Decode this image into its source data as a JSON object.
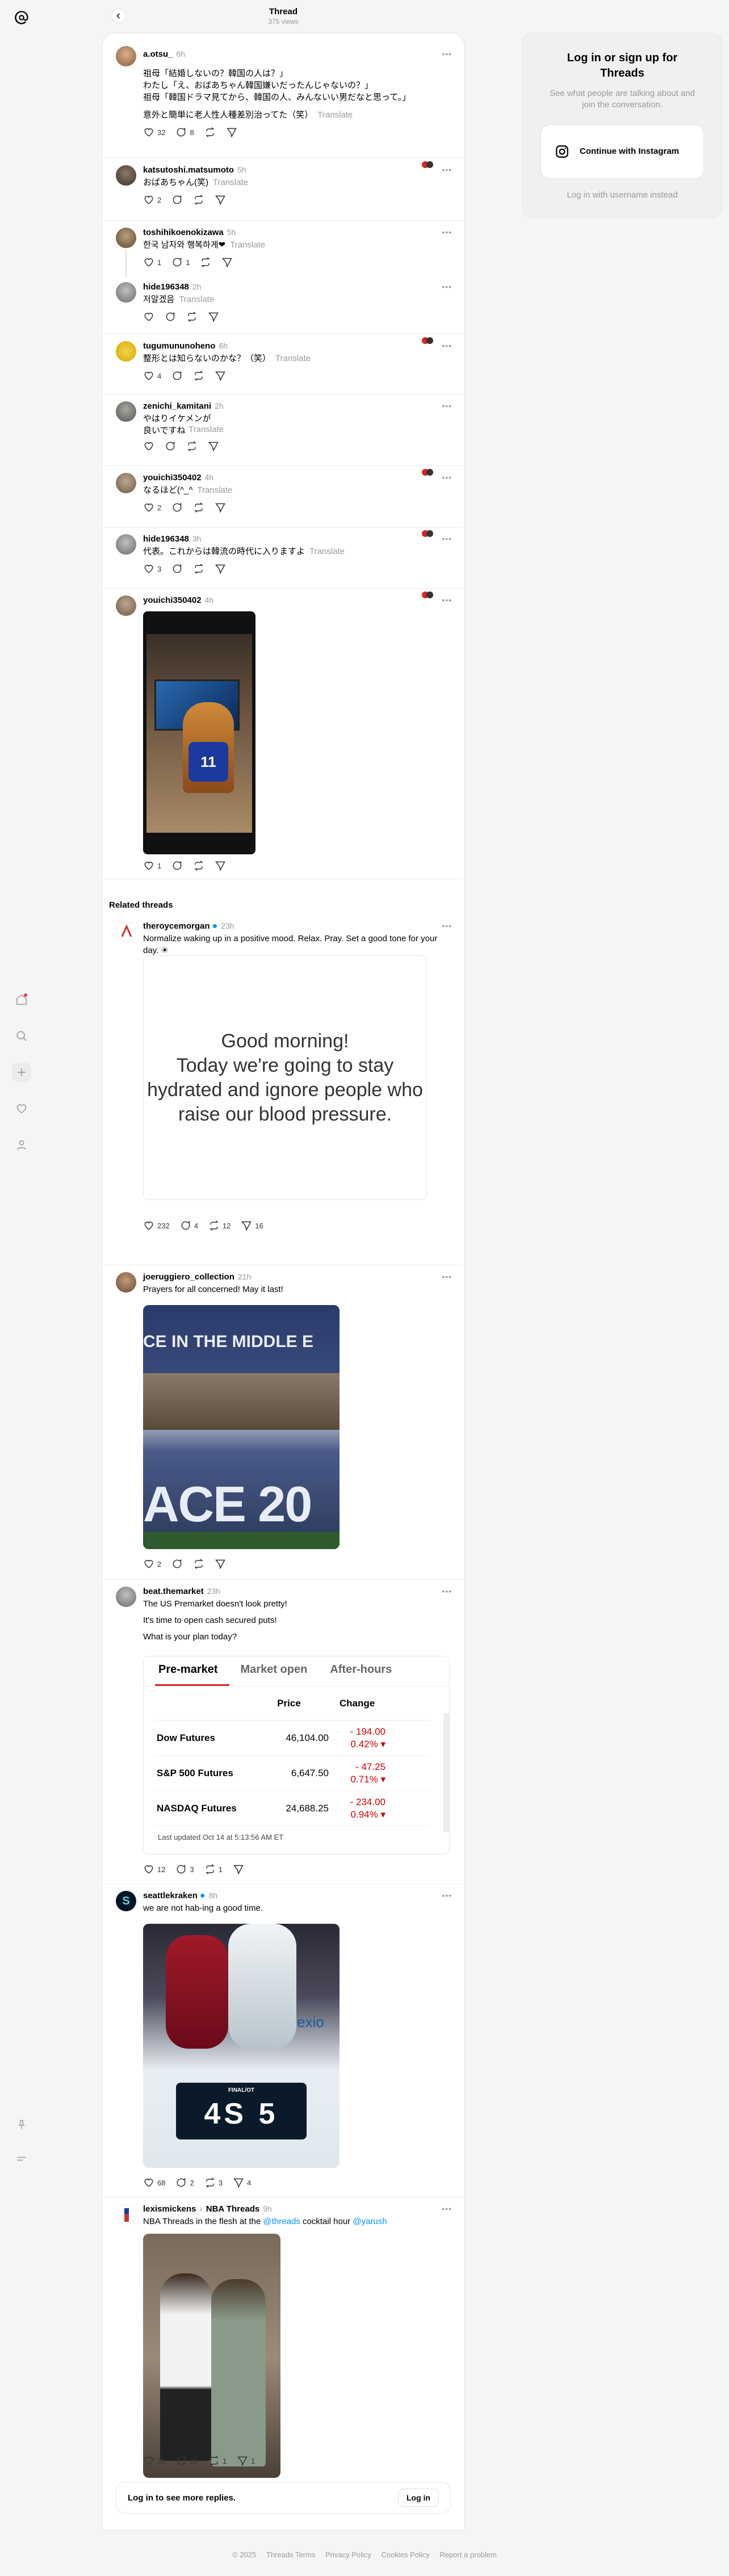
{
  "header": {
    "title": "Thread",
    "subtitle": "375 views"
  },
  "main_post": {
    "username": "a.otsu_",
    "time": "6h",
    "text": "祖母「結婚しないの？韓国の人は？」\nわたし「え、おばあちゃん韓国嫌いだったんじゃないの？」\n祖母「韓国ドラマ見てから、韓国の人、みんないい男だなと思って。」",
    "text2": "意外と簡単に老人性人種差別治ってた（笑）",
    "translate": "Translate",
    "likes": "32",
    "replies": "8"
  },
  "replies": [
    {
      "username": "katsutoshi.matsumoto",
      "time": "5h",
      "text": "おばあちゃん(笑)",
      "translate": "Translate",
      "likes": "2"
    },
    {
      "username": "toshihikoenokizawa",
      "time": "5h",
      "text": "한국 남자와 행복하게❤",
      "translate": "Translate",
      "likes": "1",
      "replies": "1"
    },
    {
      "username": "hide196348",
      "time": "2h",
      "text": "저알겠음",
      "translate": "Translate"
    },
    {
      "username": "tugumununoheno",
      "time": "6h",
      "text": "整形とは知らないのかな？（笑）",
      "translate": "Translate",
      "likes": "4"
    },
    {
      "username": "zenichi_kamitani",
      "time": "2h",
      "text": "やはりイケメンが\n良いですね",
      "translate": "Translate"
    },
    {
      "username": "youichi350402",
      "time": "4h",
      "text": "なるほど(^_^",
      "translate": "Translate",
      "likes": "2"
    },
    {
      "username": "hide196348",
      "time": "3h",
      "text": "代表。これからは韓流の時代に入りますよ",
      "translate": "Translate",
      "likes": "3"
    },
    {
      "username": "youichi350402",
      "time": "4h",
      "likes": "1"
    }
  ],
  "related_heading": "Related threads",
  "related": [
    {
      "username": "theroycemorgan",
      "time": "23h",
      "text": "Normalize waking up in a positive mood. Relax. Pray. Set a good tone for your day. ☀",
      "image_text": "Good morning!\nToday we're going to stay\nhydrated and ignore people who\nraise our blood pressure.",
      "likes": "232",
      "replies": "4",
      "reposts": "12",
      "shares": "16"
    },
    {
      "username": "joeruggiero_collection",
      "time": "21h",
      "text": "Prayers for all concerned! May it last!",
      "image_text_top": "CE IN THE MIDDLE E",
      "image_text_bottom": "ACE 20",
      "likes": "2"
    },
    {
      "username": "beat.themarket",
      "time": "23h",
      "text1": "The US Premarket doesn't look pretty!",
      "text2": "It's time to open cash secured puts!",
      "text3": "What is your plan today?",
      "likes": "12",
      "replies": "3",
      "reposts": "1"
    },
    {
      "username": "seattlekraken",
      "time": "8h",
      "text": "we are not hab-ing a good time.",
      "score_label": "FINAL/OT",
      "score_text": "4S 5",
      "board_text": "se connexio",
      "likes": "68",
      "replies": "2",
      "reposts": "3",
      "shares": "4"
    },
    {
      "username": "lexismickens",
      "community": "NBA Threads",
      "time": "9h",
      "text_pre": "NBA Threads in the flesh at the ",
      "mention1": "@threads",
      "text_mid": " cocktail hour ",
      "mention2": "@yarush",
      "likes": "36",
      "replies": "20",
      "reposts": "1",
      "shares": "1"
    }
  ],
  "market_table": {
    "tabs": [
      "Pre-market",
      "Market open",
      "After-hours"
    ],
    "columns": [
      "Price",
      "Change"
    ],
    "rows": [
      {
        "name": "Dow Futures",
        "price": "46,104.00",
        "change": "- 194.00",
        "pct": "0.42% ▾"
      },
      {
        "name": "S&P 500 Futures",
        "price": "6,647.50",
        "change": "- 47.25",
        "pct": "0.71% ▾"
      },
      {
        "name": "NASDAQ Futures",
        "price": "24,688.25",
        "change": "- 234.00",
        "pct": "0.94% ▾"
      }
    ],
    "updated": "Last updated Oct 14 at 5:13:56 AM ET"
  },
  "login_card": {
    "title": "Log in or sign up for Threads",
    "subtitle": "See what people are talking about and join the conversation.",
    "instagram_label": "Continue with Instagram",
    "username_link": "Log in with username instead"
  },
  "login_bar": {
    "text": "Log in to see more replies.",
    "button": "Log in"
  },
  "footer": [
    "© 2025",
    "Threads Terms",
    "Privacy Policy",
    "Cookies Policy",
    "Report a problem"
  ],
  "colors": {
    "accent": "#0095f6",
    "red": "#cc0000",
    "kraken": "#001628"
  }
}
